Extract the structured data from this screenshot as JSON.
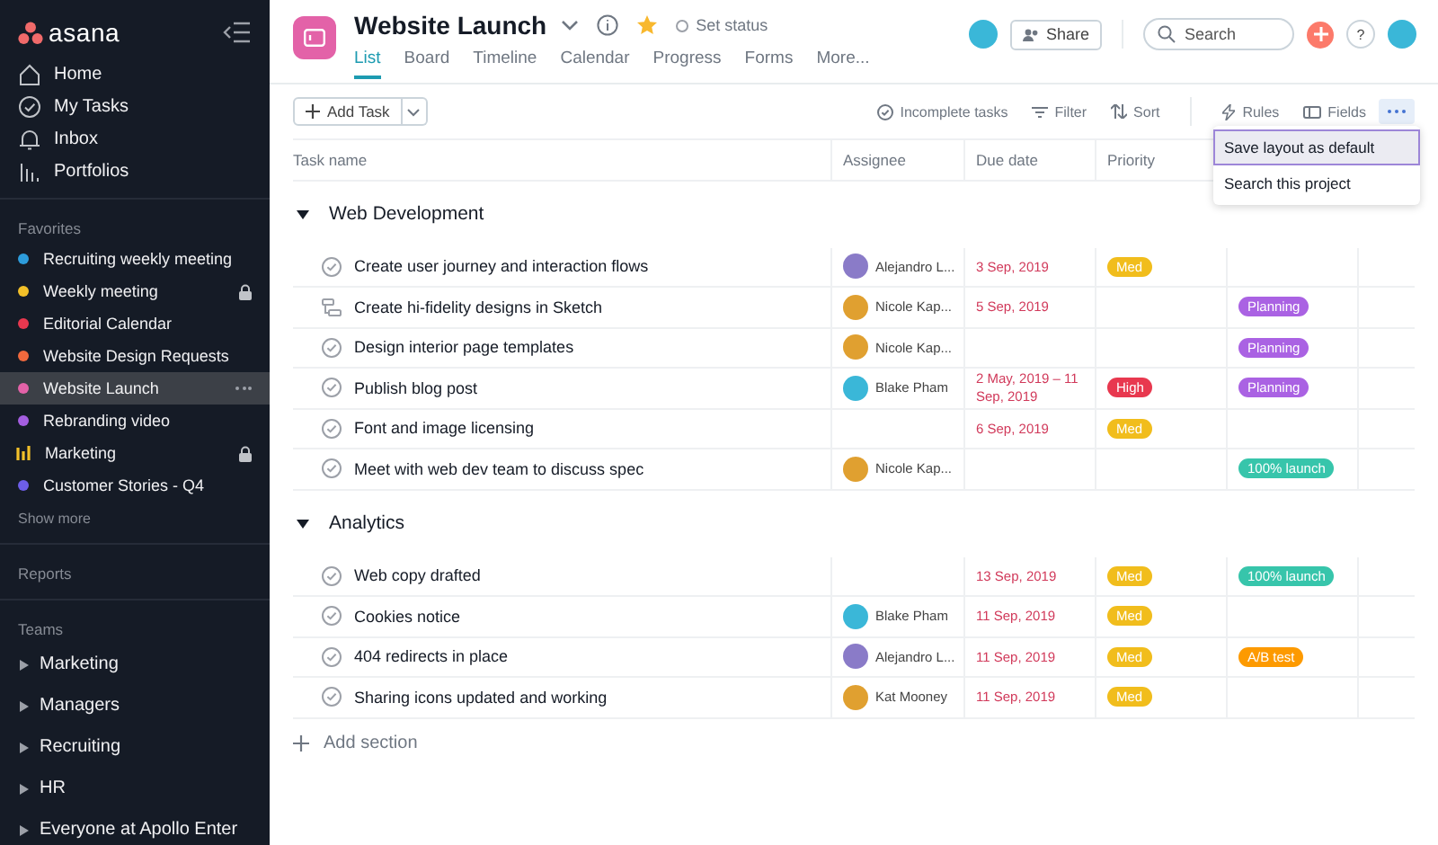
{
  "sidebar": {
    "logo": "asana",
    "nav": [
      {
        "label": "Home",
        "kind": "home"
      },
      {
        "label": "My Tasks",
        "kind": "tasks"
      },
      {
        "label": "Inbox",
        "kind": "inbox"
      },
      {
        "label": "Portfolios",
        "kind": "portfolios"
      }
    ],
    "favorites_label": "Favorites",
    "favorites": [
      {
        "label": "Recruiting weekly meeting",
        "color": "#2d9cdb",
        "kind": "dot",
        "locked": false,
        "selected": false
      },
      {
        "label": "Weekly meeting",
        "color": "#f2c029",
        "kind": "dot",
        "locked": true,
        "selected": false
      },
      {
        "label": "Editorial Calendar",
        "color": "#e8384f",
        "kind": "dot",
        "locked": false,
        "selected": false
      },
      {
        "label": "Website Design Requests",
        "color": "#f0693d",
        "kind": "dot",
        "locked": false,
        "selected": false
      },
      {
        "label": "Website Launch",
        "color": "#e362a8",
        "kind": "dot",
        "locked": false,
        "selected": true
      },
      {
        "label": "Rebranding video",
        "color": "#a45ee0",
        "kind": "dot",
        "locked": false,
        "selected": false
      },
      {
        "label": "Marketing",
        "color": "#f2c029",
        "kind": "bars",
        "locked": true,
        "selected": false
      },
      {
        "label": "Customer Stories - Q4",
        "color": "#6d5ee8",
        "kind": "dot",
        "locked": false,
        "selected": false
      }
    ],
    "show_more": "Show more",
    "reports": "Reports",
    "teams_label": "Teams",
    "teams": [
      "Marketing",
      "Managers",
      "Recruiting",
      "HR",
      "Everyone at Apollo Enter"
    ]
  },
  "header": {
    "title": "Website Launch",
    "status": "Set status",
    "tabs": [
      {
        "label": "List",
        "selected": true
      },
      {
        "label": "Board",
        "selected": false
      },
      {
        "label": "Timeline",
        "selected": false
      },
      {
        "label": "Calendar",
        "selected": false
      },
      {
        "label": "Progress",
        "selected": false
      },
      {
        "label": "Forms",
        "selected": false
      },
      {
        "label": "More...",
        "selected": false
      }
    ],
    "share": "Share",
    "search": {
      "placeholder": "Search"
    },
    "help": "?"
  },
  "toolbar": {
    "add_task": "Add Task",
    "incomplete": "Incomplete tasks",
    "filter": "Filter",
    "sort": "Sort",
    "rules": "Rules",
    "fields": "Fields"
  },
  "menu": [
    {
      "label": "Save layout as default",
      "selected": true
    },
    {
      "label": "Search this project",
      "selected": false
    }
  ],
  "table": {
    "columns": [
      "Task name",
      "Assignee",
      "Due date",
      "Priority"
    ],
    "sections": [
      {
        "title": "Web Development",
        "rows": [
          {
            "kind": "task",
            "name": "Create user journey and interaction flows",
            "assignee": "Alejandro L...",
            "avatar": {
              "color": "#8a7bc8"
            },
            "due": "3 Sep, 2019",
            "priority": {
              "label": "Med",
              "color": "#f1bd1c"
            }
          },
          {
            "kind": "subtasks",
            "name": "Create hi-fidelity designs in Sketch",
            "assignee": "Nicole Kap...",
            "avatar": {
              "color": "#e0a030"
            },
            "due": "5 Sep, 2019",
            "tag": {
              "label": "Planning",
              "color": "#aa62e3"
            }
          },
          {
            "kind": "task",
            "name": "Design interior page templates",
            "assignee": "Nicole Kap...",
            "avatar": {
              "color": "#e0a030"
            },
            "tag": {
              "label": "Planning",
              "color": "#aa62e3"
            }
          },
          {
            "kind": "task",
            "name": "Publish blog post",
            "assignee": "Blake Pham",
            "avatar": {
              "color": "#3ab7d8"
            },
            "due": "2 May, 2019 – 11 Sep, 2019",
            "priority": {
              "label": "High",
              "color": "#e8384f"
            },
            "tag": {
              "label": "Planning",
              "color": "#aa62e3"
            }
          },
          {
            "kind": "task",
            "name": "Font and image licensing",
            "due": "6 Sep, 2019",
            "priority": {
              "label": "Med",
              "color": "#f1bd1c"
            }
          },
          {
            "kind": "task",
            "name": "Meet with web dev team to discuss spec",
            "assignee": "Nicole Kap...",
            "avatar": {
              "color": "#e0a030"
            },
            "tag": {
              "label": "100% launch",
              "color": "#37c5ab"
            }
          }
        ]
      },
      {
        "title": "Analytics",
        "rows": [
          {
            "kind": "task",
            "name": "Web copy drafted",
            "due": "13 Sep, 2019",
            "priority": {
              "label": "Med",
              "color": "#f1bd1c"
            },
            "tag": {
              "label": "100% launch",
              "color": "#37c5ab"
            }
          },
          {
            "kind": "task",
            "name": "Cookies notice",
            "assignee": "Blake Pham",
            "avatar": {
              "color": "#3ab7d8"
            },
            "due": "11 Sep, 2019",
            "priority": {
              "label": "Med",
              "color": "#f1bd1c"
            }
          },
          {
            "kind": "task",
            "name": "404 redirects in place",
            "assignee": "Alejandro L...",
            "avatar": {
              "color": "#8a7bc8"
            },
            "due": "11 Sep, 2019",
            "priority": {
              "label": "Med",
              "color": "#f1bd1c"
            },
            "tag": {
              "label": "A/B test",
              "color": "#fd9a00"
            }
          },
          {
            "kind": "task",
            "name": "Sharing icons updated and working",
            "assignee": "Kat Mooney",
            "avatar": {
              "color": "#e0a030"
            },
            "due": "11 Sep, 2019",
            "priority": {
              "label": "Med",
              "color": "#f1bd1c"
            }
          }
        ]
      }
    ],
    "add_section": "Add section"
  }
}
